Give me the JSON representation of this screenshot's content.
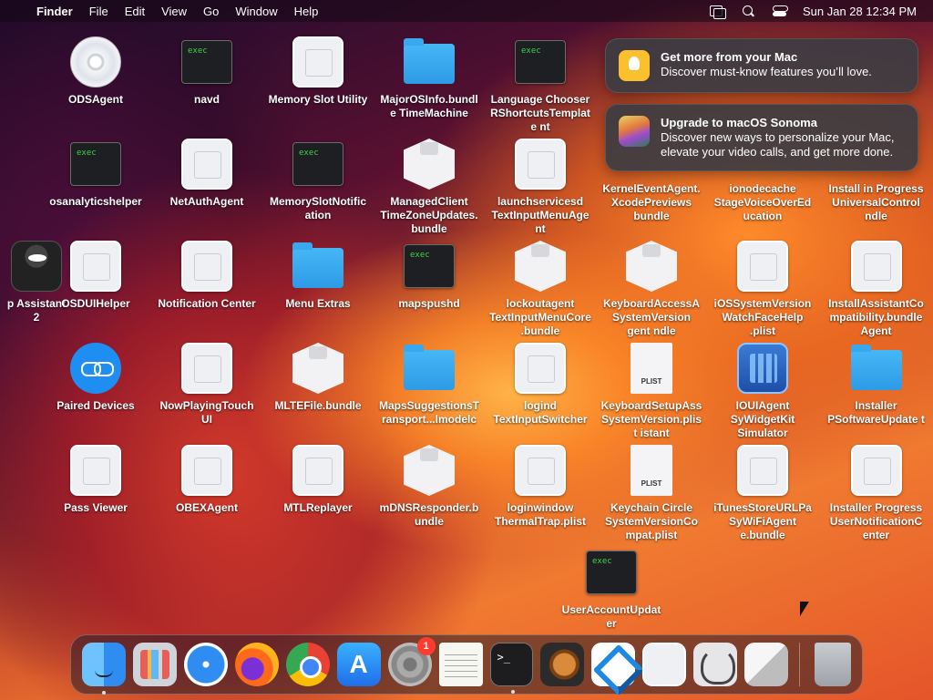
{
  "menubar": {
    "app_name": "Finder",
    "menus": [
      "File",
      "Edit",
      "View",
      "Go",
      "Window",
      "Help"
    ],
    "clock": "Sun Jan 28  12:34 PM"
  },
  "desktop_icons": [
    {
      "label": "ODSAgent"
    },
    {
      "label": "navd"
    },
    {
      "label": "Memory Slot Utility"
    },
    {
      "label": "MajorOSInfo.bundle TimeMachine"
    },
    {
      "label": "Language Chooser RShortcutsTemplate nt"
    },
    {
      "label": "osanalyticshelper"
    },
    {
      "label": "NetAuthAgent"
    },
    {
      "label": "MemorySlotNotification"
    },
    {
      "label": "ManagedClient TimeZoneUpdates. bundle"
    },
    {
      "label": "launchservicesd TextInputMenuAge nt"
    },
    {
      "label": "KernelEventAgent. XcodePreviews bundle"
    },
    {
      "label": "ionodecache StageVoiceOverEducation"
    },
    {
      "label": "Install in Progress UniversalControl ndle"
    },
    {
      "label": "p Assistant 2"
    },
    {
      "label": "OSDUIHelper"
    },
    {
      "label": "Notification Center"
    },
    {
      "label": "Menu Extras"
    },
    {
      "label": "mapspushd"
    },
    {
      "label": "lockoutagent TextInputMenuCore.bundle"
    },
    {
      "label": "KeyboardAccessA SystemVersion gent ndle"
    },
    {
      "label": "iOSSystemVersion WatchFaceHelp .plist"
    },
    {
      "label": "InstallAssistantCo mpatibility.bundle Agent"
    },
    {
      "label": "Paired Devices"
    },
    {
      "label": "NowPlayingTouch UI"
    },
    {
      "label": "MLTEFile.bundle"
    },
    {
      "label": "MapsSuggestionsTransport...lmodelc"
    },
    {
      "label": "logind TextInputSwitcher"
    },
    {
      "label": "KeyboardSetupAss SystemVersion.plist istant"
    },
    {
      "label": "IOUIAgent SyWidgetKit Simulator"
    },
    {
      "label": "Installer PSoftwareUpdate t"
    },
    {
      "label": "Pass Viewer"
    },
    {
      "label": "OBEXAgent"
    },
    {
      "label": "MTLReplayer"
    },
    {
      "label": "mDNSResponder.bundle"
    },
    {
      "label": "loginwindow ThermalTrap.plist"
    },
    {
      "label": "Keychain Circle SystemVersionCompat.plist"
    },
    {
      "label": "iTunesStoreURLPa SyWiFiAgent e.bundle"
    },
    {
      "label": "Installer Progress UserNotificationC enter"
    },
    {
      "label": "UserAccountUpdater"
    }
  ],
  "notifications": [
    {
      "title": "Get more from your Mac",
      "body": "Discover must-know features you’ll love."
    },
    {
      "title": "Upgrade to macOS Sonoma",
      "body": "Discover new ways to personalize your Mac, elevate your video calls, and get more done."
    }
  ],
  "dock": {
    "settings_badge": "1"
  },
  "icon_text": {
    "exec": "exec",
    "plist": "PLIST"
  }
}
